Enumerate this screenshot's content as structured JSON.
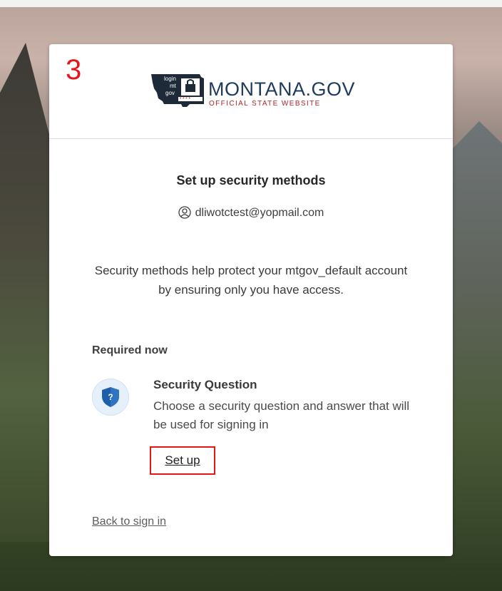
{
  "step_annotation": "3",
  "brand": {
    "logo_state_text": "login mt gov",
    "title": "MONTANA.GOV",
    "subtitle": "OFFICIAL STATE WEBSITE"
  },
  "page": {
    "title": "Set up security methods",
    "identity": {
      "icon": "user-icon",
      "email": "dliwotctest@yopmail.com"
    },
    "description": "Security methods help protect your mtgov_default account by ensuring only you have access.",
    "section_label": "Required now",
    "authenticator": {
      "icon": "security-question-shield-icon",
      "name": "Security Question",
      "description": "Choose a security question and answer that will be used for signing in",
      "action_label": "Set up"
    },
    "back_link": "Back to sign in"
  },
  "colors": {
    "annotation_red": "#e8141c",
    "brand_blue": "#1f3a5c",
    "brand_red": "#b5242a",
    "shield_blue": "#1d5fa8"
  }
}
